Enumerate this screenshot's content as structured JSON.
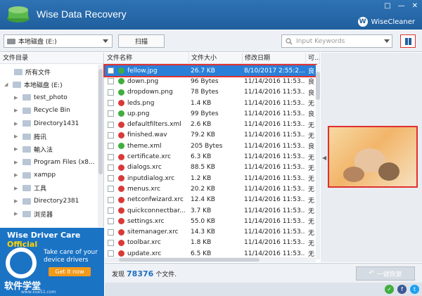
{
  "app": {
    "title": "Wise Data Recovery",
    "brand": "WiseCleaner",
    "brand_initial": "W",
    "window_buttons": [
      "□",
      "—",
      "✕"
    ]
  },
  "toolbar": {
    "drive_value": "本地磁盘 (E:)",
    "scan_label": "扫描",
    "search_placeholder": "Input Keywords"
  },
  "tree": {
    "header": "文件目录",
    "items": [
      {
        "label": "所有文件",
        "level": 1
      },
      {
        "label": "本地磁盘 (E:)",
        "level": 0
      },
      {
        "label": "test_photo",
        "level": 2
      },
      {
        "label": "Recycle Bin",
        "level": 2
      },
      {
        "label": "Directory1431",
        "level": 2
      },
      {
        "label": "腾讯",
        "level": 2
      },
      {
        "label": "輸入法",
        "level": 2
      },
      {
        "label": "Program Files (x8...",
        "level": 2
      },
      {
        "label": "xampp",
        "level": 2
      },
      {
        "label": "工具",
        "level": 2
      },
      {
        "label": "Directory2381",
        "level": 2
      },
      {
        "label": "浏览器",
        "level": 2
      }
    ]
  },
  "ad": {
    "title_a": "Wise Driver Care",
    "title_b": "Official",
    "line1": "Take care of your",
    "line2": "device drivers",
    "button": "Get it now"
  },
  "watermark": {
    "text": "软件学堂",
    "sub": "www.xue51.com"
  },
  "files": {
    "columns": [
      "文件名称",
      "文件大小",
      "修改日期",
      "可..."
    ],
    "rows": [
      {
        "name": "fellow.jpg",
        "size": "26.7 KB",
        "date": "8/10/2017 2:55:2...",
        "state": "良",
        "status": "green",
        "selected": true
      },
      {
        "name": "down.png",
        "size": "96 Bytes",
        "date": "11/14/2016 11:53...",
        "state": "良",
        "status": "green"
      },
      {
        "name": "dropdown.png",
        "size": "78 Bytes",
        "date": "11/14/2016 11:53...",
        "state": "良",
        "status": "green"
      },
      {
        "name": "leds.png",
        "size": "1.4 KB",
        "date": "11/14/2016 11:53...",
        "state": "无",
        "status": "red"
      },
      {
        "name": "up.png",
        "size": "99 Bytes",
        "date": "11/14/2016 11:53...",
        "state": "良",
        "status": "green"
      },
      {
        "name": "defaultfilters.xml",
        "size": "2.6 KB",
        "date": "11/14/2016 11:53...",
        "state": "无",
        "status": "red"
      },
      {
        "name": "finished.wav",
        "size": "79.2 KB",
        "date": "11/14/2016 11:53...",
        "state": "无",
        "status": "red"
      },
      {
        "name": "theme.xml",
        "size": "205 Bytes",
        "date": "11/14/2016 11:53...",
        "state": "良",
        "status": "green"
      },
      {
        "name": "certificate.xrc",
        "size": "6.3 KB",
        "date": "11/14/2016 11:53...",
        "state": "无",
        "status": "red"
      },
      {
        "name": "dialogs.xrc",
        "size": "88.5 KB",
        "date": "11/14/2016 11:53...",
        "state": "无",
        "status": "red"
      },
      {
        "name": "inputdialog.xrc",
        "size": "1.2 KB",
        "date": "11/14/2016 11:53...",
        "state": "无",
        "status": "red"
      },
      {
        "name": "menus.xrc",
        "size": "20.2 KB",
        "date": "11/14/2016 11:53...",
        "state": "无",
        "status": "red"
      },
      {
        "name": "netconfwizard.xrc",
        "size": "12.4 KB",
        "date": "11/14/2016 11:53...",
        "state": "无",
        "status": "red"
      },
      {
        "name": "quickconnectbar...",
        "size": "3.7 KB",
        "date": "11/14/2016 11:53...",
        "state": "无",
        "status": "red"
      },
      {
        "name": "settings.xrc",
        "size": "55.0 KB",
        "date": "11/14/2016 11:53...",
        "state": "无",
        "status": "red"
      },
      {
        "name": "sitemanager.xrc",
        "size": "14.3 KB",
        "date": "11/14/2016 11:53...",
        "state": "无",
        "status": "red"
      },
      {
        "name": "toolbar.xrc",
        "size": "1.8 KB",
        "date": "11/14/2016 11:53...",
        "state": "无",
        "status": "red"
      },
      {
        "name": "update.xrc",
        "size": "6.5 KB",
        "date": "11/14/2016 11:53...",
        "state": "无",
        "status": "red"
      }
    ]
  },
  "status": {
    "prefix": "发现",
    "count": "78376",
    "suffix": "个文件.",
    "recover_label": "一键恢复"
  },
  "social": [
    "✓",
    "f",
    "t"
  ],
  "colors": {
    "accent": "#1f5f9e",
    "selected": "#2a80d8",
    "ok": "#3fae3f",
    "bad": "#d83a3a",
    "highlight_border": "#e03030"
  }
}
